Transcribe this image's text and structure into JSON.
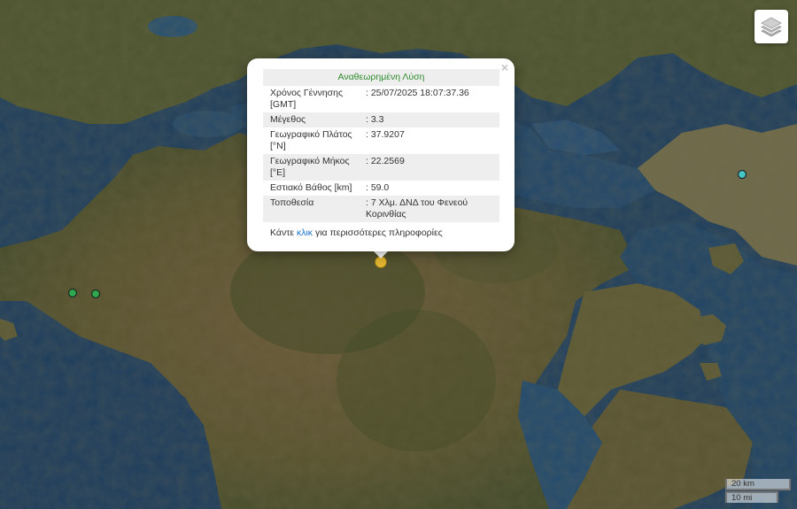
{
  "popup": {
    "title": "Αναθεωρημένη Λύση",
    "rows": [
      {
        "label": "Χρόνος Γέννησης [GMT]",
        "value": ": 25/07/2025 18:07:37.36"
      },
      {
        "label": "Μέγεθος",
        "value": ": 3.3"
      },
      {
        "label": "Γεωγραφικό Πλάτος [°N]",
        "value": ": 37.9207"
      },
      {
        "label": "Γεωγραφικό Μήκος [°E]",
        "value": ": 22.2569"
      },
      {
        "label": "Εστιακό Βάθος [km]",
        "value": ": 59.0"
      },
      {
        "label": "Τοποθεσία",
        "value": ": 7 Χλμ. ΔΝΔ του Φενεού Κορινθίας"
      }
    ],
    "more_prefix": "Κάντε ",
    "more_link": "κλικ",
    "more_suffix": " για περισσότερες πληροφορίες",
    "close": "×"
  },
  "scale": {
    "metric": "20 km",
    "imperial": "10 mi"
  },
  "colors": {
    "selected_event": "#e2b52f",
    "event_green": "#2fa84e",
    "event_cyan": "#45c5c3"
  },
  "icons": {
    "layers": "layers-icon"
  }
}
